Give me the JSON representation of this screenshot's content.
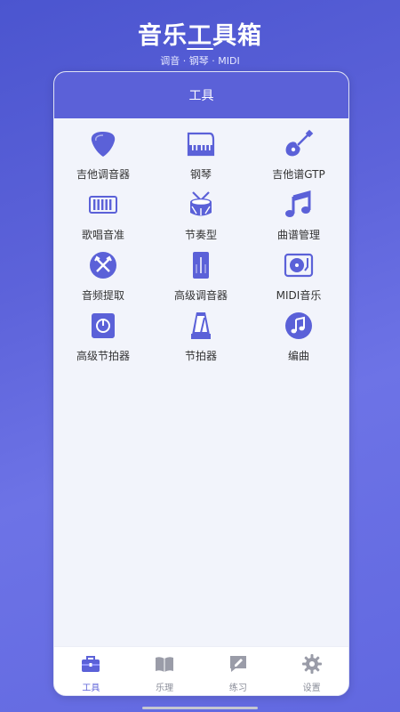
{
  "header": {
    "title": "音乐工具箱",
    "subtitle": "调音 · 钢琴 · MIDI"
  },
  "card": {
    "title": "工具"
  },
  "tools": [
    {
      "label": "吉他调音器",
      "icon": "guitar-pick-icon"
    },
    {
      "label": "钢琴",
      "icon": "piano-icon"
    },
    {
      "label": "吉他谱GTP",
      "icon": "guitar-icon"
    },
    {
      "label": "歌唱音准",
      "icon": "keyboard-icon"
    },
    {
      "label": "节奏型",
      "icon": "drum-icon"
    },
    {
      "label": "曲谱管理",
      "icon": "music-note-icon"
    },
    {
      "label": "音频提取",
      "icon": "audio-extract-icon"
    },
    {
      "label": "高级调音器",
      "icon": "tuner-device-icon"
    },
    {
      "label": "MIDI音乐",
      "icon": "turntable-icon"
    },
    {
      "label": "高级节拍器",
      "icon": "metronome-box-icon"
    },
    {
      "label": "节拍器",
      "icon": "metronome-icon"
    },
    {
      "label": "编曲",
      "icon": "note-circle-icon"
    }
  ],
  "tabs": [
    {
      "label": "工具",
      "icon": "toolbox-icon",
      "active": true
    },
    {
      "label": "乐理",
      "icon": "book-icon",
      "active": false
    },
    {
      "label": "练习",
      "icon": "practice-icon",
      "active": false
    },
    {
      "label": "设置",
      "icon": "gear-icon",
      "active": false
    }
  ],
  "colors": {
    "accent": "#5b61d8",
    "tab_inactive": "#8a8d99"
  }
}
